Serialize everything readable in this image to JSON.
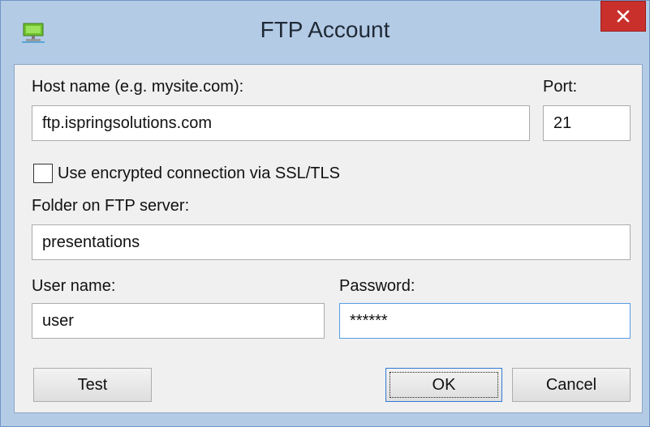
{
  "window": {
    "title": "FTP Account",
    "app_icon": "network-computer-icon",
    "close_icon": "close-icon",
    "colors": {
      "close_bg": "#c9302c",
      "frame": "#b4cbe6",
      "focus_border": "#569de5"
    }
  },
  "form": {
    "host_label": "Host name (e.g. mysite.com):",
    "host_value": "ftp.ispringsolutions.com",
    "port_label": "Port:",
    "port_value": "21",
    "ssl_label": "Use encrypted connection via SSL/TLS",
    "ssl_checked": false,
    "folder_label": "Folder on FTP server:",
    "folder_value": "presentations",
    "user_label": "User name:",
    "user_value": "user",
    "password_label": "Password:",
    "password_value": "******"
  },
  "buttons": {
    "test": "Test",
    "ok": "OK",
    "cancel": "Cancel"
  }
}
